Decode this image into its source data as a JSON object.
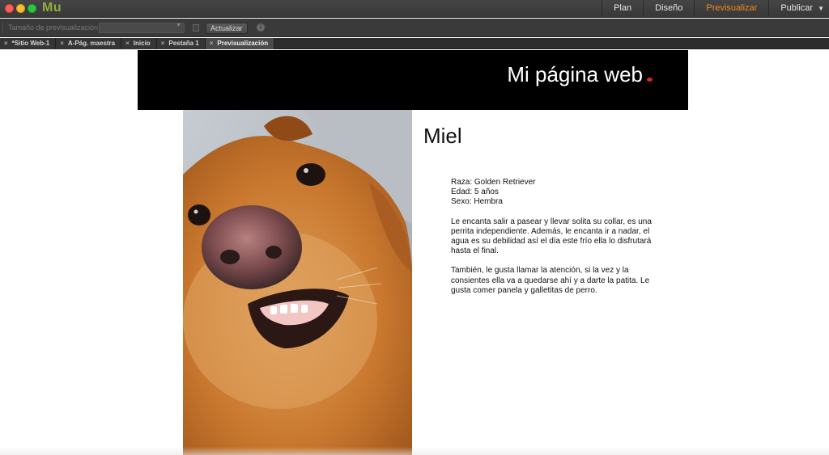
{
  "app": {
    "logo": "Mu",
    "modes": [
      "Plan",
      "Diseño",
      "Previsualizar",
      "Publicar"
    ],
    "active_mode": "Previsualizar",
    "accent_color": "#f08a1f"
  },
  "toolbar": {
    "preview_size_label": "Tamaño de previsualización:",
    "preview_size_value": "",
    "refresh_label": "Actualizar"
  },
  "tabs": [
    {
      "label": "*Sitio Web-1"
    },
    {
      "label": "A-Pág. maestra"
    },
    {
      "label": "Inicio"
    },
    {
      "label": "Pestaña 1"
    },
    {
      "label": "Previsualización",
      "active": true
    }
  ],
  "site": {
    "title": "Mi página web",
    "header_bg": "#000000",
    "dot_color": "#e0221c"
  },
  "pet": {
    "name": "Miel",
    "breed": "Raza: Golden Retriever",
    "age": "Edad: 5 años",
    "sex": "Sexo: Hembra",
    "paragraph1": "Le encanta salir a pasear y llevar solita su collar, es una perrita independiente. Además, le encanta ir a nadar, el agua es su debilidad así el día este frío ella lo disfrutará hasta el final.",
    "paragraph2": "También, le gusta llamar la atención, si la vez y la consientes ella va a quedarse ahí y a darte la patita. Le gusta comer panela y galletitas de perro."
  }
}
